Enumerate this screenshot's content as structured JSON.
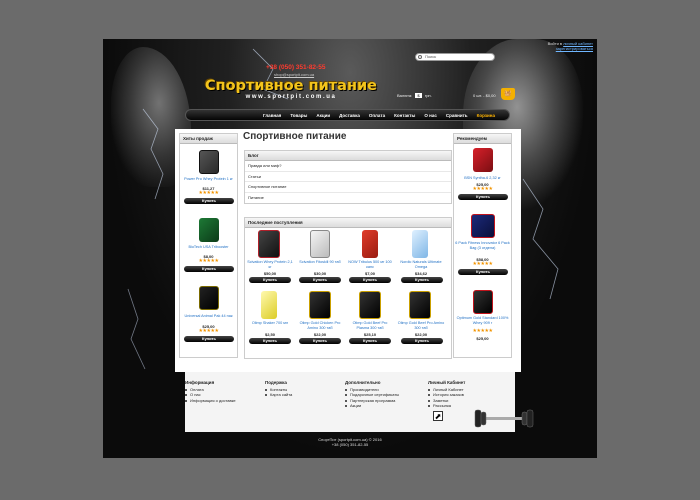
{
  "header": {
    "top_login_prefix": "Войти в",
    "top_login_link": "личный кабинет",
    "top_register_link": "зарегистрироваться",
    "search_placeholder": "Поиск",
    "phone": "+38 (050) 351-82-55",
    "email": "shop@sportpit.com.ua",
    "logo_text": "Спортивное питание",
    "logo_url": "www.sportpit.com.ua",
    "currency_label": "Валюта:",
    "currency_value": "$",
    "currency_alt": "грн.",
    "cart_summary": "0 шт. - $0,00"
  },
  "nav": {
    "items": [
      {
        "label": "Главная"
      },
      {
        "label": "Товары"
      },
      {
        "label": "Акции"
      },
      {
        "label": "Доставка"
      },
      {
        "label": "Оплата"
      },
      {
        "label": "Контакты"
      },
      {
        "label": "О нас"
      },
      {
        "label": "Сравнить"
      },
      {
        "label": "Корзина"
      }
    ]
  },
  "left_sidebar": {
    "title": "Хиты продаж",
    "items": [
      {
        "name": "Power Pro Whey Protein 1 кг",
        "price": "$11,27",
        "buy": "Купить"
      },
      {
        "name": "BioTech USA Tribooster",
        "price": "$8,00",
        "buy": "Купить"
      },
      {
        "name": "Universal Animal Pak 44 пак",
        "price": "$25,00",
        "buy": "Купить"
      }
    ]
  },
  "right_sidebar": {
    "title": "Рекомендуем",
    "items": [
      {
        "name": "BSN Syntha-6 2,32 кг",
        "price": "$25,00",
        "buy": "Купить"
      },
      {
        "name": "6 Pack Fitness Innovator 6 Pack Bag (3 отдела)",
        "price": "$58,00",
        "buy": "Купить"
      },
      {
        "name": "Optimum Gold Standard 100% Whey 909 г",
        "price": "$25,00",
        "buy": "Купить"
      }
    ]
  },
  "main": {
    "title": "Спортивное питание",
    "blog": {
      "title": "Блог",
      "items": [
        "Правда или миф?",
        "Статьи",
        "Спортивное питание",
        "Питание"
      ]
    },
    "recent": {
      "title": "Последние поступления",
      "products": [
        {
          "name": "Scivation Whey Protein 2,1 кг",
          "price": "$50,00",
          "buy": "Купить"
        },
        {
          "name": "Scivation Fitoskill 90 таб",
          "price": "$30,00",
          "buy": "Купить"
        },
        {
          "name": "NOW Tribulus 500 мг 100 капс",
          "price": "$7,00",
          "buy": "Купить"
        },
        {
          "name": "Nordic Naturals Ultimate Omega",
          "price": "$34,62",
          "buy": "Купить"
        },
        {
          "name": "Olimp Shaker 700 мл",
          "price": "$2,50",
          "buy": "Купить"
        },
        {
          "name": "Olimp Gold Chicken Pro Amino 300 таб",
          "price": "$22,00",
          "buy": "Купить"
        },
        {
          "name": "Olimp Gold Beef Pro Plasma 300 таб",
          "price": "$25,10",
          "buy": "Купить"
        },
        {
          "name": "Olimp Gold Beef Pro Amino 300 таб",
          "price": "$22,00",
          "buy": "Купить"
        }
      ]
    }
  },
  "footer": {
    "columns": [
      {
        "title": "Информация",
        "items": [
          "Оплата",
          "О нас",
          "Информация о доставке"
        ]
      },
      {
        "title": "Подержка",
        "items": [
          "Контакты",
          "Карта сайта"
        ]
      },
      {
        "title": "Дополнительно",
        "items": [
          "Производители",
          "Подарочные сертификаты",
          "Партнерская программа",
          "Акции"
        ]
      },
      {
        "title": "Личный Кабинет",
        "items": [
          "Личный Кабинет",
          "История заказов",
          "Заметки",
          "Рассылка"
        ]
      }
    ],
    "copyright": "СпортПит (sportpit.com.ua) © 2016",
    "copyright_phone": "+38 (050) 351-82-55"
  },
  "colors": {
    "accent": "#f4b000",
    "link": "#1f6fc4",
    "phone": "#ff3b2f",
    "star": "#f29400"
  },
  "ratings": {
    "stars": "★★★★★"
  }
}
